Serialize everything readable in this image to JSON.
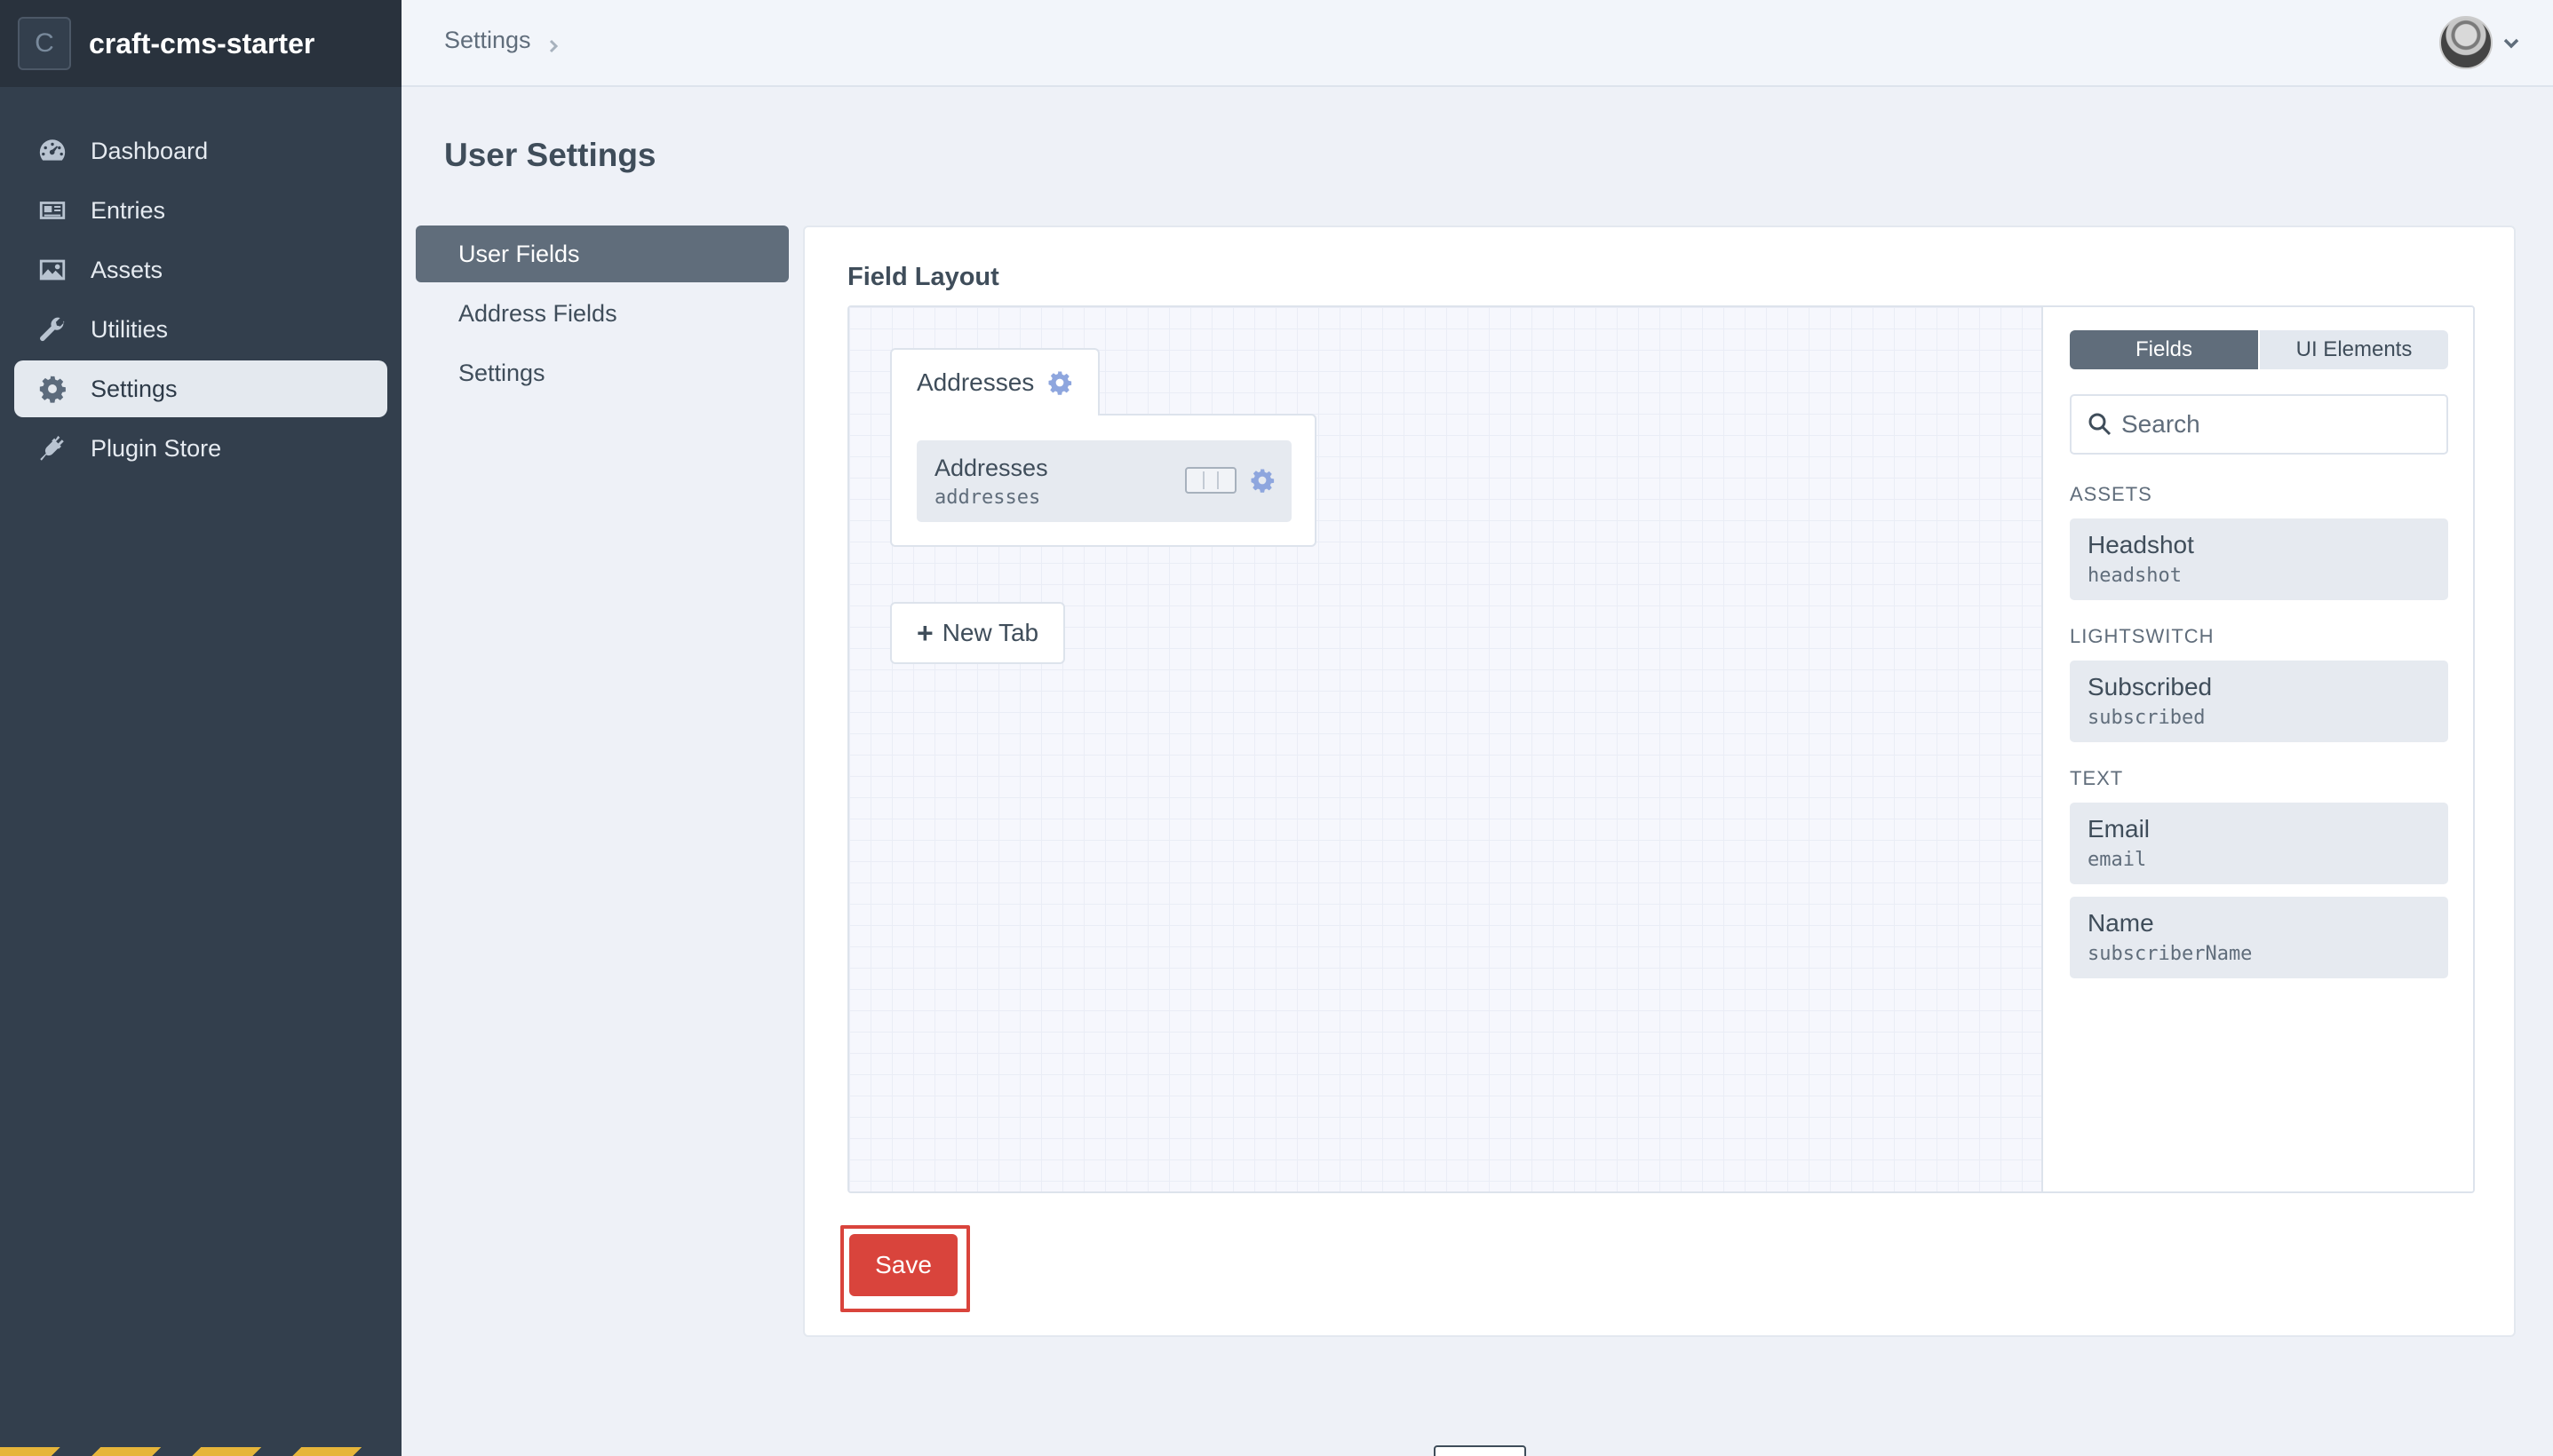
{
  "brand": {
    "badge": "C",
    "name": "craft-cms-starter"
  },
  "sidebar": {
    "items": [
      {
        "label": "Dashboard",
        "icon": "dashboard-gauge-icon"
      },
      {
        "label": "Entries",
        "icon": "newspaper-icon"
      },
      {
        "label": "Assets",
        "icon": "image-icon"
      },
      {
        "label": "Utilities",
        "icon": "wrench-icon"
      },
      {
        "label": "Settings",
        "icon": "gear-icon",
        "active": true
      },
      {
        "label": "Plugin Store",
        "icon": "plug-icon"
      }
    ]
  },
  "header": {
    "breadcrumb": "Settings"
  },
  "page": {
    "title": "User Settings"
  },
  "subnav": {
    "items": [
      {
        "label": "User Fields",
        "active": true
      },
      {
        "label": "Address Fields"
      },
      {
        "label": "Settings"
      }
    ]
  },
  "field_layout": {
    "label": "Field Layout",
    "tab": {
      "name": "Addresses"
    },
    "fields": [
      {
        "name": "Addresses",
        "handle": "addresses"
      }
    ],
    "new_tab_label": "New Tab"
  },
  "library": {
    "tabs": [
      {
        "label": "Fields",
        "active": true
      },
      {
        "label": "UI Elements"
      }
    ],
    "search_placeholder": "Search",
    "groups": [
      {
        "label": "ASSETS",
        "items": [
          {
            "name": "Headshot",
            "handle": "headshot"
          }
        ]
      },
      {
        "label": "LIGHTSWITCH",
        "items": [
          {
            "name": "Subscribed",
            "handle": "subscribed"
          }
        ]
      },
      {
        "label": "TEXT",
        "items": [
          {
            "name": "Email",
            "handle": "email"
          },
          {
            "name": "Name",
            "handle": "subscriberName"
          }
        ]
      }
    ]
  },
  "actions": {
    "save_label": "Save"
  },
  "colors": {
    "accent_red": "#d9443c",
    "sidebar_bg": "#333f4d",
    "gear_blue": "#8ea6de"
  }
}
